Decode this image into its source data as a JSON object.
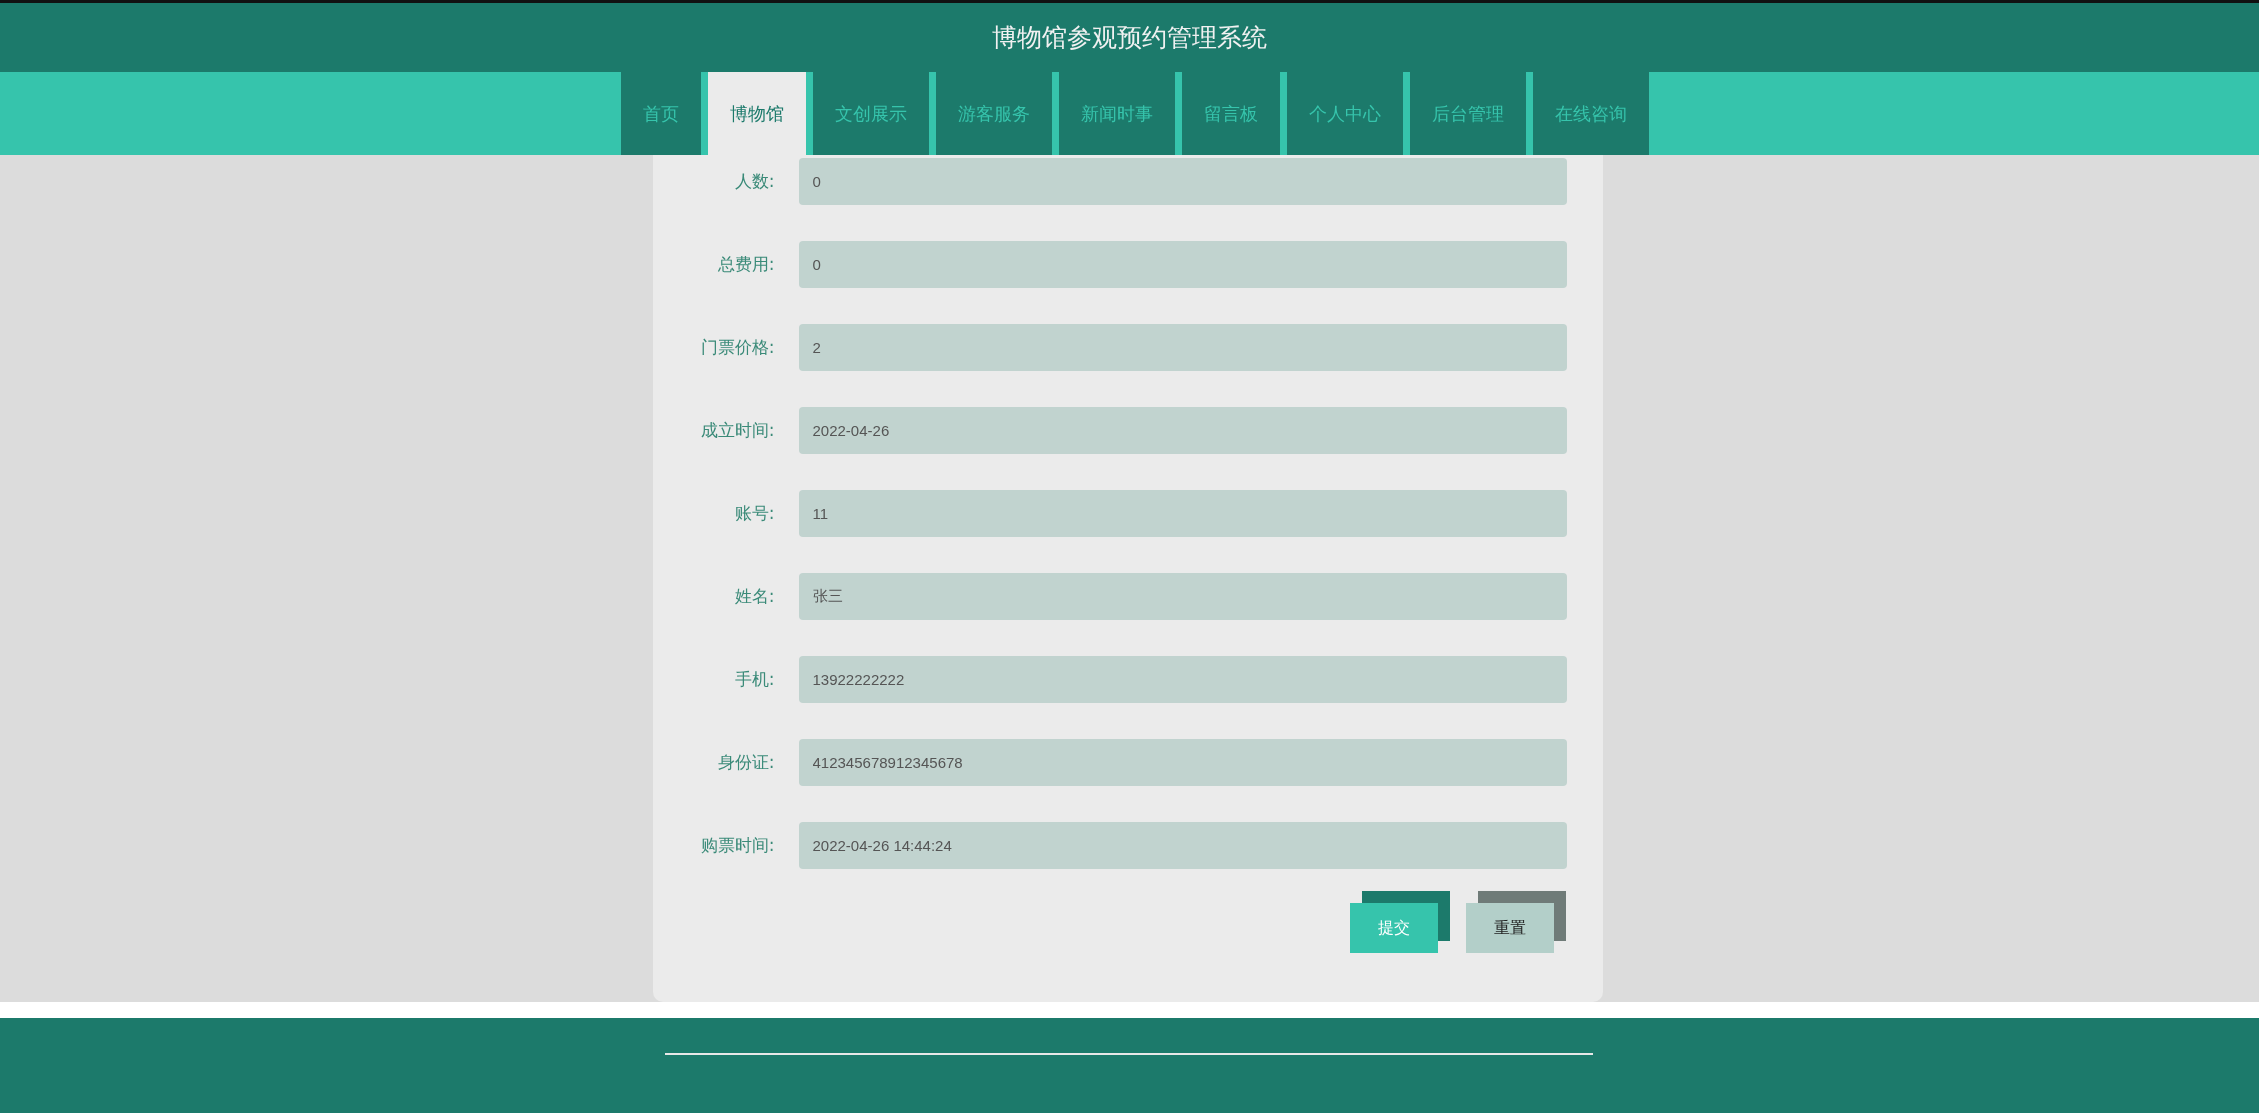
{
  "header": {
    "title": "博物馆参观预约管理系统"
  },
  "nav": [
    {
      "label": "首页",
      "selected": false
    },
    {
      "label": "博物馆",
      "selected": true
    },
    {
      "label": "文创展示",
      "selected": false
    },
    {
      "label": "游客服务",
      "selected": false
    },
    {
      "label": "新闻时事",
      "selected": false
    },
    {
      "label": "留言板",
      "selected": false
    },
    {
      "label": "个人中心",
      "selected": false
    },
    {
      "label": "后台管理",
      "selected": false
    },
    {
      "label": "在线咨询",
      "selected": false
    }
  ],
  "form": {
    "fields": [
      {
        "label": "人数:",
        "value": "0"
      },
      {
        "label": "总费用:",
        "value": "0"
      },
      {
        "label": "门票价格:",
        "value": "2"
      },
      {
        "label": "成立时间:",
        "value": "2022-04-26"
      },
      {
        "label": "账号:",
        "value": "11"
      },
      {
        "label": "姓名:",
        "value": "张三"
      },
      {
        "label": "手机:",
        "value": "13922222222"
      },
      {
        "label": "身份证:",
        "value": "412345678912345678"
      },
      {
        "label": "购票时间:",
        "value": "2022-04-26 14:44:24"
      }
    ],
    "buttons": [
      {
        "label": "提交",
        "kind": "submit"
      },
      {
        "label": "重置",
        "kind": "reset"
      }
    ]
  }
}
